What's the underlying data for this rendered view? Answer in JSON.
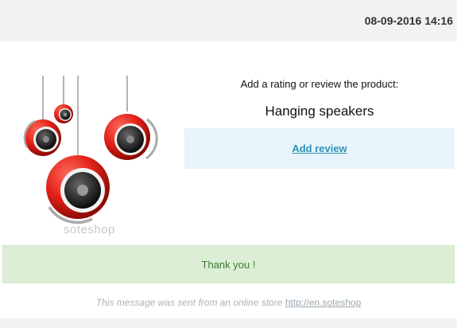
{
  "header": {
    "datetime": "08-09-2016 14:16"
  },
  "product": {
    "image_icon": "hanging-speakers-image",
    "watermark": "soteshop",
    "prompt": "Add a rating or review the product:",
    "name": "Hanging speakers",
    "review_link": "Add review"
  },
  "thanks": {
    "text": "Thank you !"
  },
  "footer": {
    "text": "This message was sent from an online store",
    "link": "http://en.soteshop"
  },
  "colors": {
    "header_bg": "#f2f2f2",
    "review_bg": "#e8f4fb",
    "link": "#2f95b7",
    "thanks_bg": "#dcefd6",
    "thanks_text": "#3b7a2c",
    "speaker_red": "#e32219"
  }
}
